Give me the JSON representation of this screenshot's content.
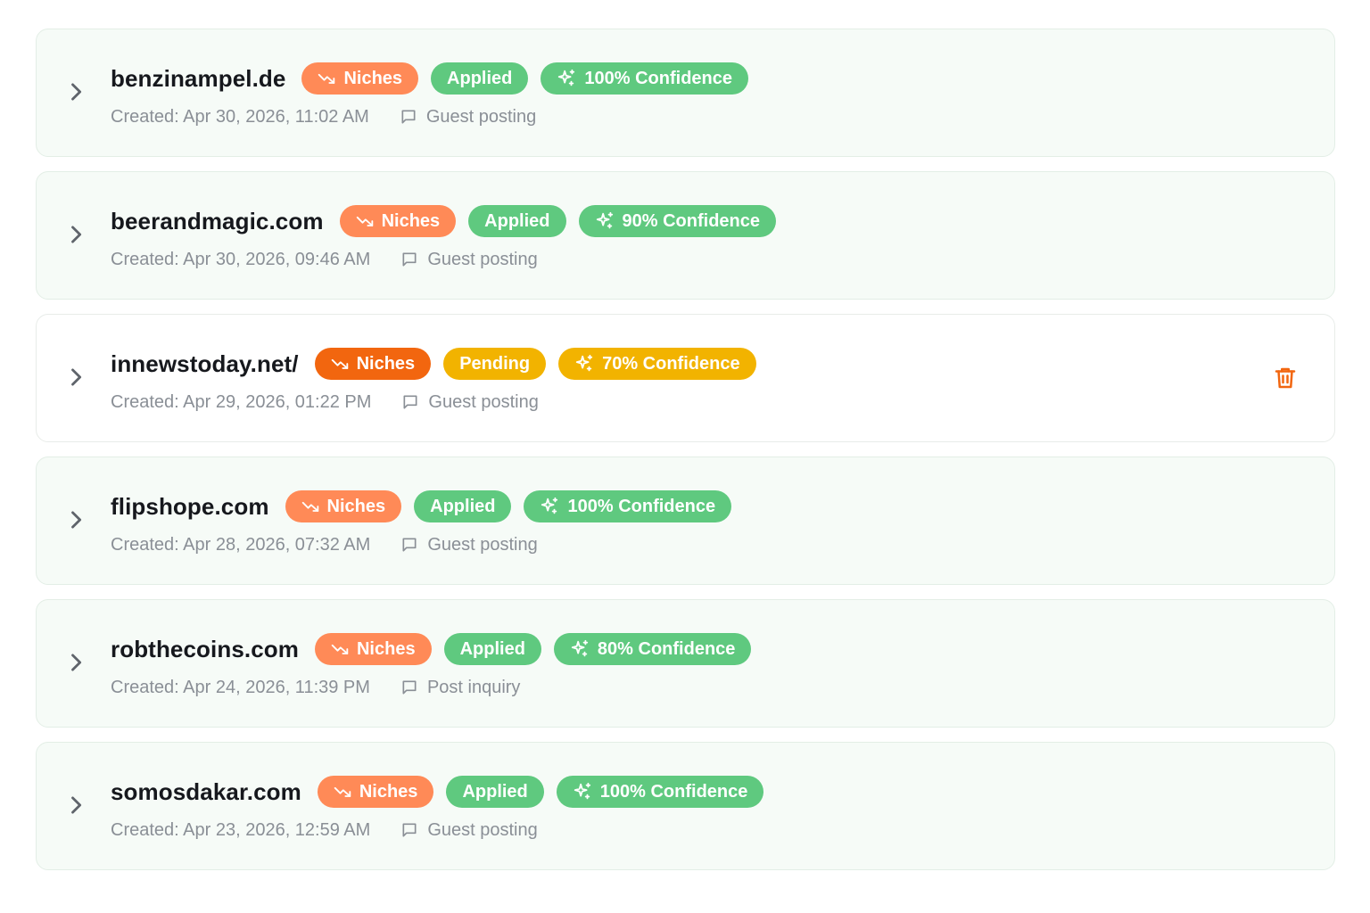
{
  "colors": {
    "niches_applied": "#ff8a57",
    "niches_pending": "#f2660f",
    "applied": "#5fc97f",
    "pending": "#f2b300",
    "confidence_applied": "#5fc97f",
    "confidence_pending": "#f2b300",
    "trash": "#f2660f"
  },
  "icons": {
    "expand": "chevron-right-icon",
    "niches": "trending-down-icon",
    "confidence": "sparkles-icon",
    "type": "message-square-icon",
    "delete": "trash-icon"
  },
  "items": [
    {
      "domain": "benzinampel.de",
      "niches_label": "Niches",
      "status": "Applied",
      "confidence": "100% Confidence",
      "created": "Created: Apr 30, 2026, 11:02 AM",
      "type": "Guest posting"
    },
    {
      "domain": "beerandmagic.com",
      "niches_label": "Niches",
      "status": "Applied",
      "confidence": "90% Confidence",
      "created": "Created: Apr 30, 2026, 09:46 AM",
      "type": "Guest posting"
    },
    {
      "domain": "innewstoday.net/",
      "niches_label": "Niches",
      "status": "Pending",
      "confidence": "70% Confidence",
      "created": "Created: Apr 29, 2026, 01:22 PM",
      "type": "Guest posting"
    },
    {
      "domain": "flipshope.com",
      "niches_label": "Niches",
      "status": "Applied",
      "confidence": "100% Confidence",
      "created": "Created: Apr 28, 2026, 07:32 AM",
      "type": "Guest posting"
    },
    {
      "domain": "robthecoins.com",
      "niches_label": "Niches",
      "status": "Applied",
      "confidence": "80% Confidence",
      "created": "Created: Apr 24, 2026, 11:39 PM",
      "type": "Post inquiry"
    },
    {
      "domain": "somosdakar.com",
      "niches_label": "Niches",
      "status": "Applied",
      "confidence": "100% Confidence",
      "created": "Created: Apr 23, 2026, 12:59 AM",
      "type": "Guest posting"
    }
  ]
}
